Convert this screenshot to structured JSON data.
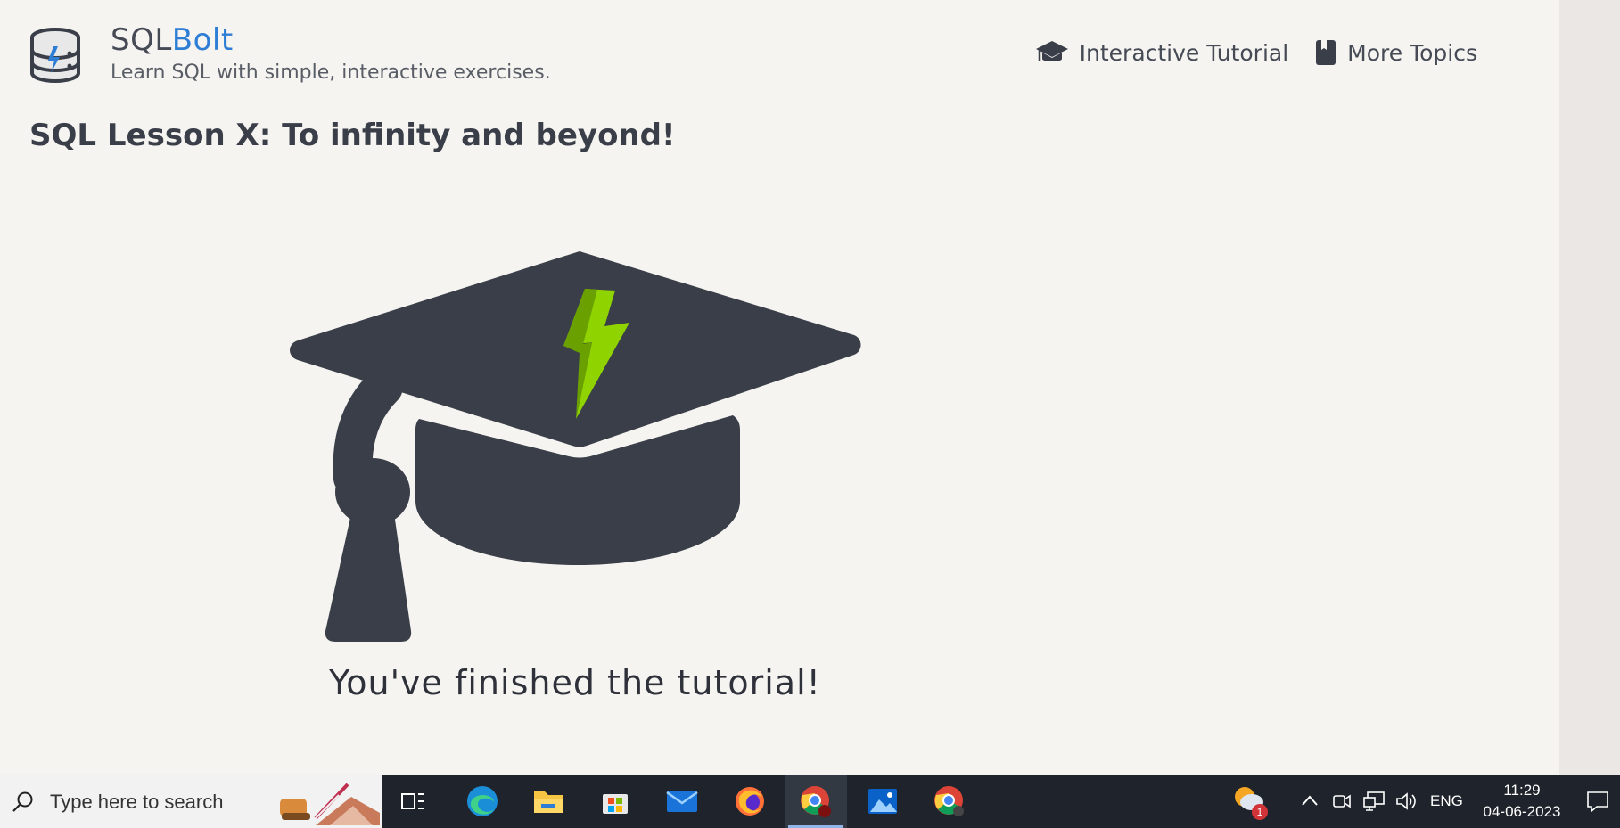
{
  "header": {
    "brand_prefix": "SQL",
    "brand_accent": "Bolt",
    "tagline": "Learn SQL with simple, interactive exercises.",
    "nav": [
      {
        "label": "Interactive Tutorial",
        "icon": "graduation-cap-icon"
      },
      {
        "label": "More Topics",
        "icon": "book-icon"
      }
    ]
  },
  "main": {
    "lesson_title": "SQL Lesson X: To infinity and beyond!",
    "finished_text": "You've finished the tutorial!",
    "illustration": "graduation-cap-with-bolt"
  },
  "taskbar": {
    "search_placeholder": "Type here to search",
    "apps": [
      "task-view-icon",
      "edge-icon",
      "file-explorer-icon",
      "microsoft-store-icon",
      "mail-icon",
      "firefox-icon",
      "chrome-icon",
      "photos-icon",
      "chrome-icon"
    ],
    "weather_badge": "1",
    "language": "ENG",
    "time": "11:29",
    "date": "04-06-2023"
  },
  "colors": {
    "background": "#f5f4f1",
    "accent": "#2e7ed6",
    "cap": "#3a3e48",
    "bolt": "#8fd400",
    "taskbar": "#1f232b"
  }
}
